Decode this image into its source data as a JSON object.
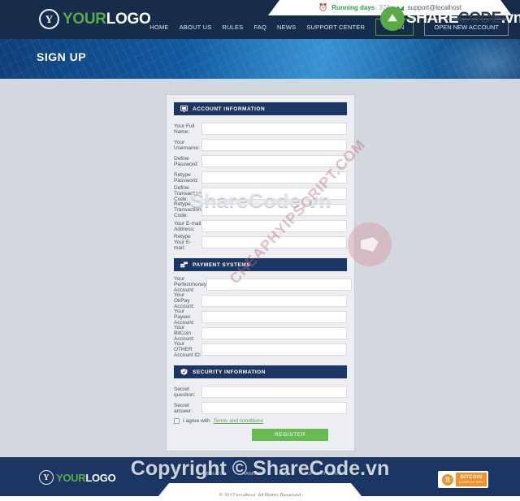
{
  "header": {
    "logo": {
      "icon": "y-circle-logo",
      "part1": "YOUR",
      "part2": "LOGO"
    },
    "topbar": {
      "clock_icon": "clock-icon",
      "running_label": "Running days",
      "running_days": "374",
      "mail_icon": "envelope-icon",
      "email": "support@localhost"
    },
    "nav": [
      {
        "label": "HOME"
      },
      {
        "label": "ABOUT US"
      },
      {
        "label": "RULES"
      },
      {
        "label": "FAQ"
      },
      {
        "label": "NEWS"
      },
      {
        "label": "SUPPORT CENTER"
      }
    ],
    "login_button": "LOGIN",
    "open_account_button": "OPEN NEW ACCOUNT"
  },
  "banner": {
    "title": "SIGN UP"
  },
  "form": {
    "sections": [
      {
        "icon": "monitor-icon",
        "title": "ACCOUNT INFORMATION",
        "fields": [
          {
            "label": "Your Full Name:",
            "value": ""
          },
          {
            "label": "Your Username:",
            "value": ""
          },
          {
            "label": "Define Password:",
            "value": ""
          },
          {
            "label": "Retype Password:",
            "value": ""
          },
          {
            "label": "Define Transaction Code:",
            "value": ""
          },
          {
            "label": "Retype Transaction Code:",
            "value": ""
          },
          {
            "label": "Your E-mail Address:",
            "value": ""
          },
          {
            "label": "Retype Your E-mail:",
            "value": ""
          }
        ]
      },
      {
        "icon": "payment-stack-icon",
        "title": "PAYMENT SYSTEMS",
        "fields": [
          {
            "label": "Your Perfectmoney Account:",
            "value": ""
          },
          {
            "label": "Your OkPay Account:",
            "value": ""
          },
          {
            "label": "Your Payeer Account:",
            "value": ""
          },
          {
            "label": "Your BitCoin Account:",
            "value": ""
          },
          {
            "label": "Your OTHER Account ID:",
            "value": ""
          }
        ]
      },
      {
        "icon": "shield-icon",
        "title": "SECURITY INFORMATION",
        "fields": [
          {
            "label": "Secret question:",
            "value": ""
          },
          {
            "label": "Secret answer:",
            "value": ""
          }
        ]
      }
    ],
    "agree_text": "I agree with",
    "terms_link": "Terms and conditions",
    "register_button": "REGISTER"
  },
  "footer": {
    "logo": {
      "icon": "y-circle-logo",
      "part1": "YOUR",
      "part2": "LOGO"
    },
    "nav": [
      {
        "label": "ABOUT US"
      },
      {
        "label": "RANKING"
      },
      {
        "label": "FAQ"
      },
      {
        "label": "SUPPORT CENTER"
      }
    ],
    "bitcoin_badge": {
      "icon": "bitcoin-icon",
      "line1": "BITCOIN",
      "line2": "ACCEPTED HERE"
    },
    "copyright": "© 2017 localhost. All Rights Reserved"
  },
  "watermarks": {
    "top_logo": {
      "icon": "sharecode-leaf-icon",
      "s1": "SHARE",
      "s2": "CODE",
      "s3": ".vn"
    },
    "center": "ShareCode.vn",
    "diagonal": "CHEAPHYIPSCRIPT.COM",
    "footer": "Copyright © ShareCode.vn"
  },
  "colors": {
    "header_bg": "#152c4b",
    "section_header": "#1b3663",
    "accent_green": "#5aab46",
    "register_green": "#67bb52",
    "content_bg": "#d3d7de",
    "bitcoin_orange": "#f3922b"
  }
}
